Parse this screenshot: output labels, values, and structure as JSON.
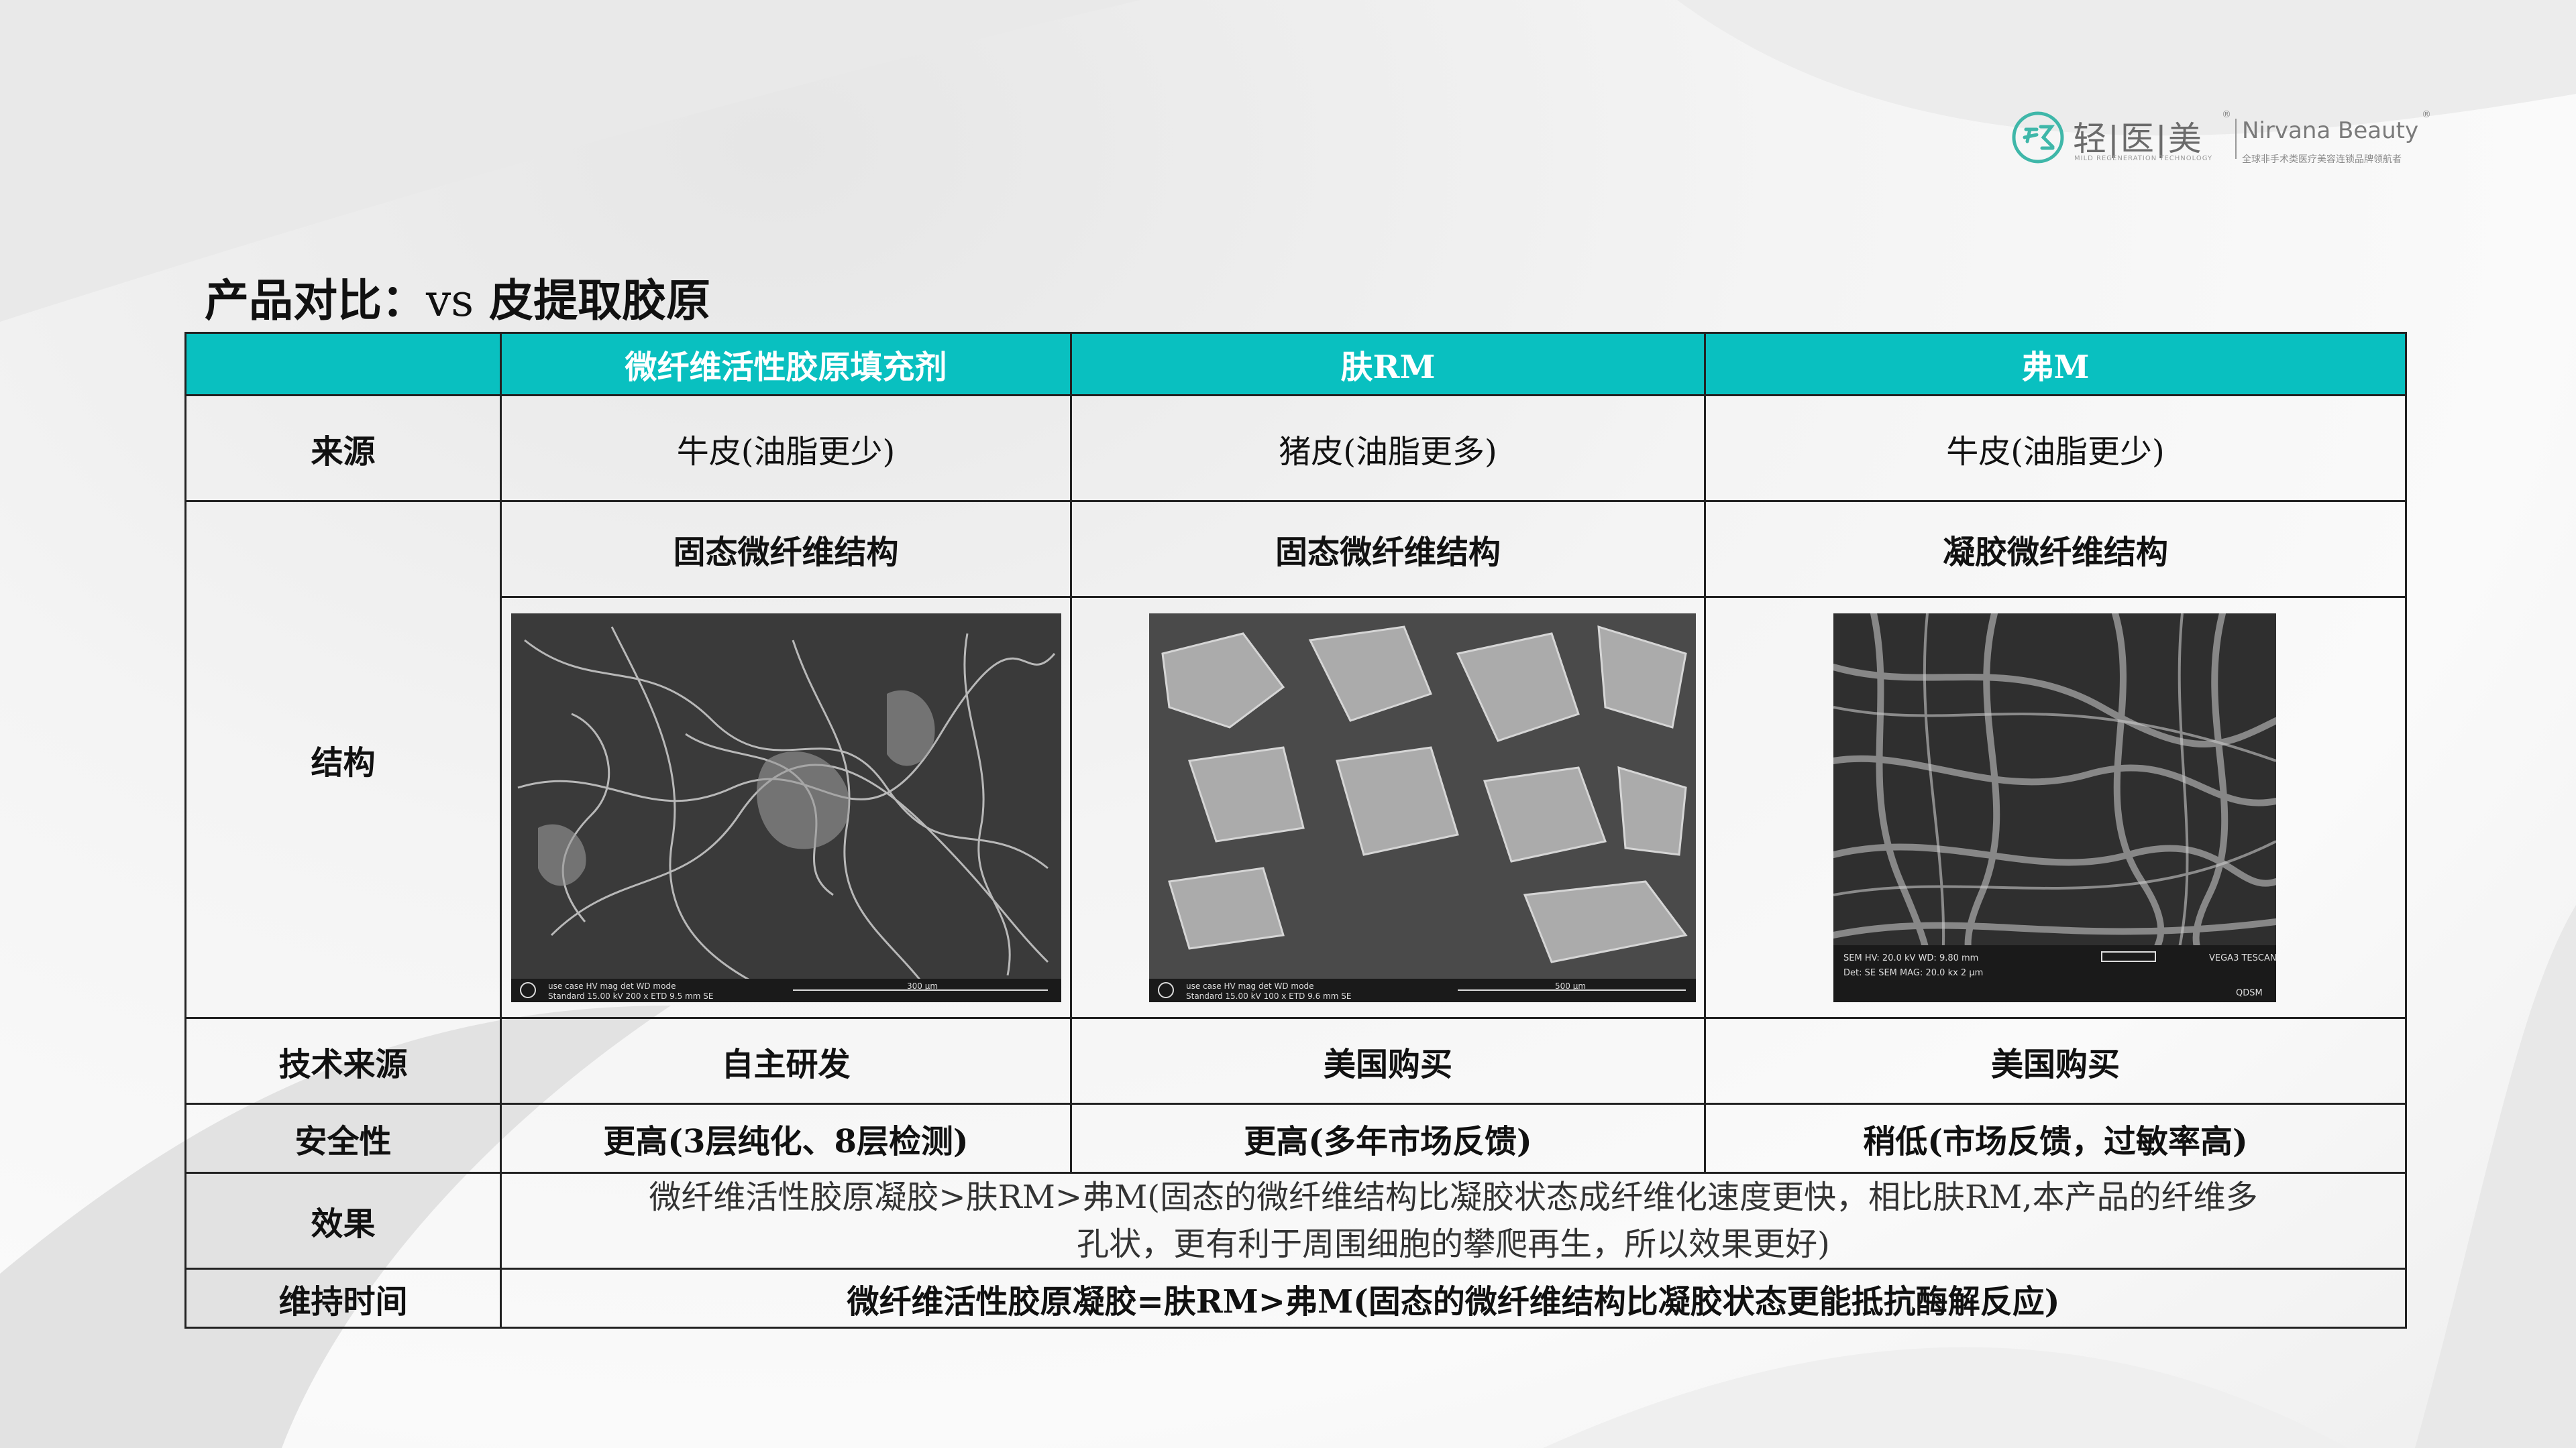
{
  "logo": {
    "brand_cn": "轻|医|美",
    "brand_en": "Nirvana Beauty",
    "registered": "®",
    "tagline_en": "MILD REGENERATION TECHNOLOGY",
    "tagline_cn": "全球非手术类医疗美容连锁品牌领航者",
    "icon": "leaf-circle-logo-icon",
    "color": "#3fb7a9"
  },
  "title": {
    "prefix": "产品对比：",
    "vs": "vs",
    "suffix": " 皮提取胶原"
  },
  "table": {
    "header_color": "#09c0c0",
    "headers": [
      "",
      "微纤维活性胶原填充剂",
      "肤RM",
      "弗M"
    ],
    "rows": {
      "source": {
        "label": "来源",
        "values": [
          "牛皮(油脂更少)",
          "猪皮(油脂更多)",
          "牛皮(油脂更少)"
        ]
      },
      "structure": {
        "label": "结构",
        "values": [
          "固态微纤维结构",
          "固态微纤维结构",
          "凝胶微纤维结构"
        ],
        "images": [
          {
            "icon": "sem-micrograph-solid-fiber",
            "meta": "use case  HV  mag  det  WD  mode",
            "meta2": "Standard 15.00 kV 200 x ETD 9.5 mm SE",
            "scale": "300 μm"
          },
          {
            "icon": "sem-micrograph-solid-fiber",
            "meta": "use case  HV  mag  det  WD  mode",
            "meta2": "Standard 15.00 kV 100 x ETD 9.6 mm SE",
            "scale": "500 μm"
          },
          {
            "icon": "sem-micrograph-gel-fiber",
            "meta": "SEM HV: 20.0 kV   WD: 9.80 mm",
            "meta2": "Det: SE   SEM MAG: 20.0 kx   2 μm",
            "brand": "VEGA3 TESCAN",
            "corner": "QDSM"
          }
        ]
      },
      "tech_source": {
        "label": "技术来源",
        "values": [
          "自主研发",
          "美国购买",
          "美国购买"
        ]
      },
      "safety": {
        "label": "安全性",
        "values": [
          "更高(3层纯化、8层检测)",
          "更高(多年市场反馈)",
          "稍低(市场反馈，过敏率高)"
        ]
      },
      "effect": {
        "label": "效果",
        "line1": "微纤维活性胶原凝胶>肤RM>弗M(固态的微纤维结构比凝胶状态成纤维化速度更快，相比肤RM,本产品的纤维多",
        "line2": "孔状，更有利于周围细胞的攀爬再生，所以效果更好)"
      },
      "duration": {
        "label": "维持时间",
        "value": "微纤维活性胶原凝胶=肤RM>弗M(固态的微纤维结构比凝胶状态更能抵抗酶解反应)"
      }
    }
  }
}
